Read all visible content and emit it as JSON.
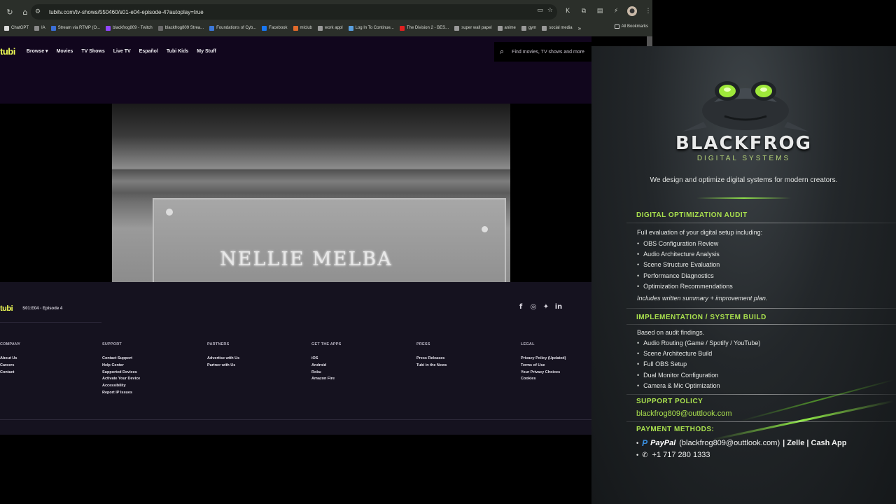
{
  "browser": {
    "url": "tubitv.com/tv-shows/550460/s01-e04-episode-4?autoplay=true",
    "bookmarks": [
      {
        "label": "ChatGPT",
        "color": "#d9d9d9"
      },
      {
        "label": "IA",
        "color": "#8a8a8a"
      },
      {
        "label": "Stream via RTMP (O...",
        "color": "#3b6fd6"
      },
      {
        "label": "blackfrog809 - Twitch",
        "color": "#9146ff"
      },
      {
        "label": "blackfrog809 Strea...",
        "color": "#6a6a6a"
      },
      {
        "label": "Foundations of Cyb...",
        "color": "#3c78d8"
      },
      {
        "label": "Facebook",
        "color": "#1877f2"
      },
      {
        "label": "mlclub",
        "color": "#e06a2b"
      },
      {
        "label": "work appl",
        "color": "#9a9a9a"
      },
      {
        "label": "Log In To Continue...",
        "color": "#5aa0e0"
      },
      {
        "label": "The Division 2 - BES...",
        "color": "#e02020"
      },
      {
        "label": "super wall papel",
        "color": "#9a9a9a"
      },
      {
        "label": "anime",
        "color": "#9a9a9a"
      },
      {
        "label": "gym",
        "color": "#9a9a9a"
      },
      {
        "label": "social media",
        "color": "#9a9a9a"
      }
    ],
    "more_bookmarks": "»",
    "all_bookmarks": "All Bookmarks"
  },
  "tubi": {
    "logo": "tubi",
    "nav": [
      "Browse ▾",
      "Movies",
      "TV Shows",
      "Live TV",
      "Español",
      "Tubi Kids",
      "My Stuff"
    ],
    "search_placeholder": "Find movies, TV shows and more",
    "video_caption": "NELLIE MELBA",
    "footer": {
      "logo": "tubi",
      "episode": "S01:E04 - Episode 4",
      "columns": [
        {
          "head": "COMPANY",
          "items": [
            "About Us",
            "Careers",
            "Contact"
          ]
        },
        {
          "head": "SUPPORT",
          "items": [
            "Contact Support",
            "Help Center",
            "Supported Devices",
            "Activate Your Device",
            "Accessibility",
            "Report IP Issues"
          ]
        },
        {
          "head": "PARTNERS",
          "items": [
            "Advertise with Us",
            "Partner with Us"
          ]
        },
        {
          "head": "GET THE APPS",
          "items": [
            "iOS",
            "Android",
            "Roku",
            "Amazon Fire"
          ]
        },
        {
          "head": "PRESS",
          "items": [
            "Press Releases",
            "Tubi in the News"
          ]
        },
        {
          "head": "LEGAL",
          "items": [
            "Privacy Policy (Updated)",
            "Terms of Use",
            "Your Privacy Choices",
            "Cookies"
          ]
        }
      ]
    }
  },
  "blackfrog": {
    "brand": "BLACKFROG",
    "brand_sub": "DIGITAL SYSTEMS",
    "tagline": "We design and optimize digital systems for modern creators.",
    "audit": {
      "title": "DIGITAL OPTIMIZATION AUDIT",
      "intro": "Full evaluation of your digital setup including:",
      "items": [
        "OBS Configuration Review",
        "Audio Architecture Analysis",
        "Scene Structure Evaluation",
        "Performance Diagnostics",
        "Optimization Recommendations"
      ],
      "note": "Includes written summary + improvement plan."
    },
    "build": {
      "title": "IMPLEMENTATION / SYSTEM BUILD",
      "intro": "Based on audit findings.",
      "items": [
        "Audio Routing (Game / Spotify / YouTube)",
        "Scene Architecture Build",
        "Full OBS Setup",
        "Dual Monitor Configuration",
        "Camera & Mic Optimization"
      ]
    },
    "support": {
      "title": "SUPPORT POLICY",
      "email": "blackfrog809@outtlook.com"
    },
    "payment": {
      "title": "PAYMENT METHODS:",
      "paypal": "PayPal",
      "paypal_detail": "(blackfrog809@outtlook.com)",
      "others": "| Zelle | Cash App",
      "phone": "+1 717 280 1333"
    }
  }
}
